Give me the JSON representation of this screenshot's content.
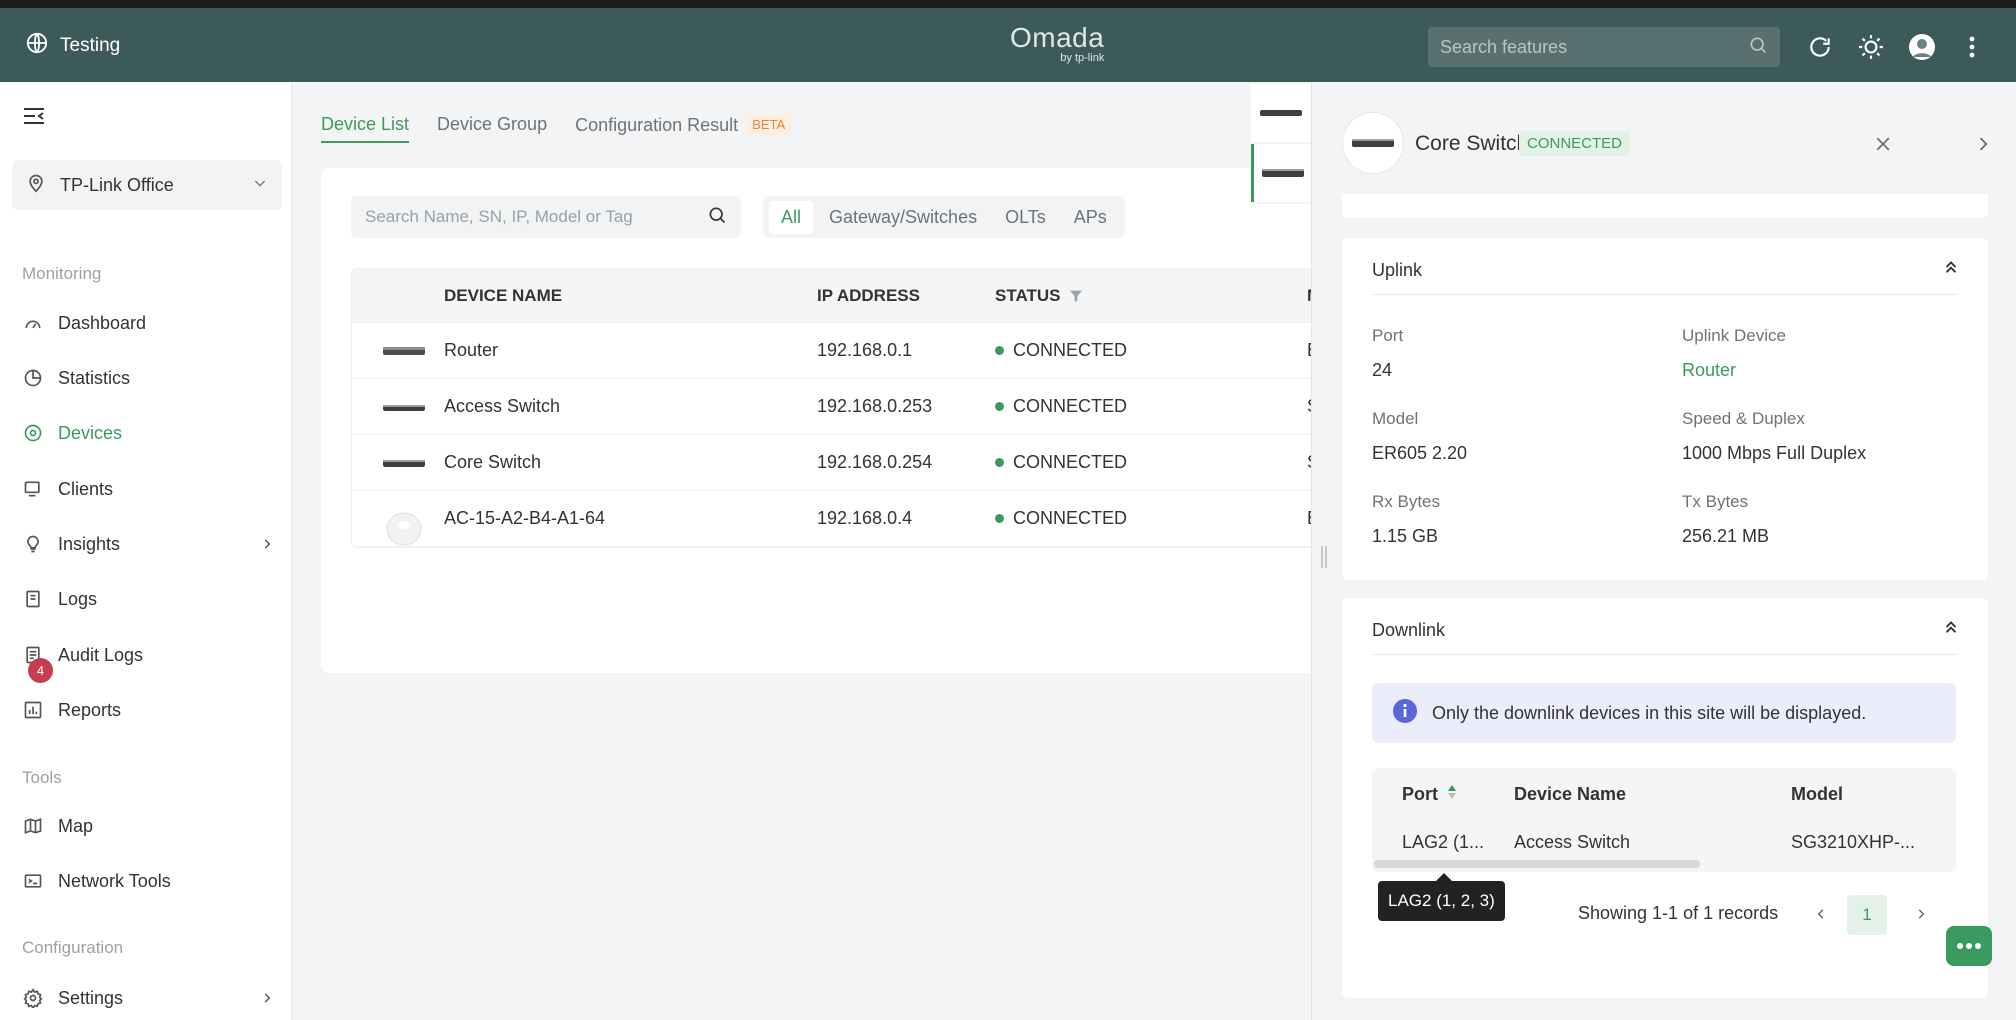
{
  "header": {
    "site_name": "Testing",
    "logo_text": "Omada",
    "logo_sub": "by tp-link",
    "search_placeholder": "Search features"
  },
  "sidebar": {
    "site_select": "TP-Link Office",
    "sections": {
      "monitoring": "Monitoring",
      "tools": "Tools",
      "configuration": "Configuration"
    },
    "items": [
      {
        "label": "Dashboard",
        "icon": "dashboard-icon"
      },
      {
        "label": "Statistics",
        "icon": "pie-chart-icon"
      },
      {
        "label": "Devices",
        "icon": "devices-icon",
        "active": true
      },
      {
        "label": "Clients",
        "icon": "clients-icon"
      },
      {
        "label": "Insights",
        "icon": "lightbulb-icon"
      },
      {
        "label": "Logs",
        "icon": "logs-icon",
        "badge": "4"
      },
      {
        "label": "Audit Logs",
        "icon": "audit-logs-icon"
      },
      {
        "label": "Reports",
        "icon": "reports-icon"
      },
      {
        "label": "Map",
        "icon": "map-icon"
      },
      {
        "label": "Network Tools",
        "icon": "network-tools-icon"
      },
      {
        "label": "Settings",
        "icon": "settings-icon"
      }
    ]
  },
  "main": {
    "tabs": [
      "Device List",
      "Device Group",
      "Configuration Result"
    ],
    "beta_label": "BETA",
    "search_placeholder": "Search Name, SN, IP, Model or Tag",
    "filters": [
      "All",
      "Gateway/Switches",
      "OLTs",
      "APs"
    ],
    "columns": [
      "DEVICE NAME",
      "IP ADDRESS",
      "STATUS"
    ],
    "rows": [
      {
        "name": "Router",
        "ip": "192.168.0.1",
        "status": "CONNECTED",
        "extra": "E"
      },
      {
        "name": "Access Switch",
        "ip": "192.168.0.253",
        "status": "CONNECTED",
        "extra": "S"
      },
      {
        "name": "Core Switch",
        "ip": "192.168.0.254",
        "status": "CONNECTED",
        "extra": "S"
      },
      {
        "name": "AC-15-A2-B4-A1-64",
        "ip": "192.168.0.4",
        "status": "CONNECTED",
        "extra": "E"
      }
    ]
  },
  "panel": {
    "device_name": "Core Switch",
    "status": "CONNECTED",
    "uplink": {
      "title": "Uplink",
      "port_label": "Port",
      "port": "24",
      "uplink_device_label": "Uplink Device",
      "uplink_device": "Router",
      "model_label": "Model",
      "model": "ER605 2.20",
      "speed_label": "Speed & Duplex",
      "speed": "1000 Mbps Full Duplex",
      "rx_label": "Rx Bytes",
      "rx": "1.15 GB",
      "tx_label": "Tx Bytes",
      "tx": "256.21 MB"
    },
    "downlink": {
      "title": "Downlink",
      "notice": "Only the downlink devices in this site will be displayed.",
      "columns": [
        "Port",
        "Device Name",
        "Model"
      ],
      "row": {
        "port": "LAG2 (1...",
        "device": "Access Switch",
        "model": "SG3210XHP-..."
      },
      "tooltip": "LAG2 (1, 2, 3)",
      "pager_text": "Showing 1-1 of 1 records",
      "page": "1"
    }
  },
  "colors": {
    "header": "#3d5a5a",
    "accent": "#3b9b5e",
    "badge": "#c53d52"
  }
}
